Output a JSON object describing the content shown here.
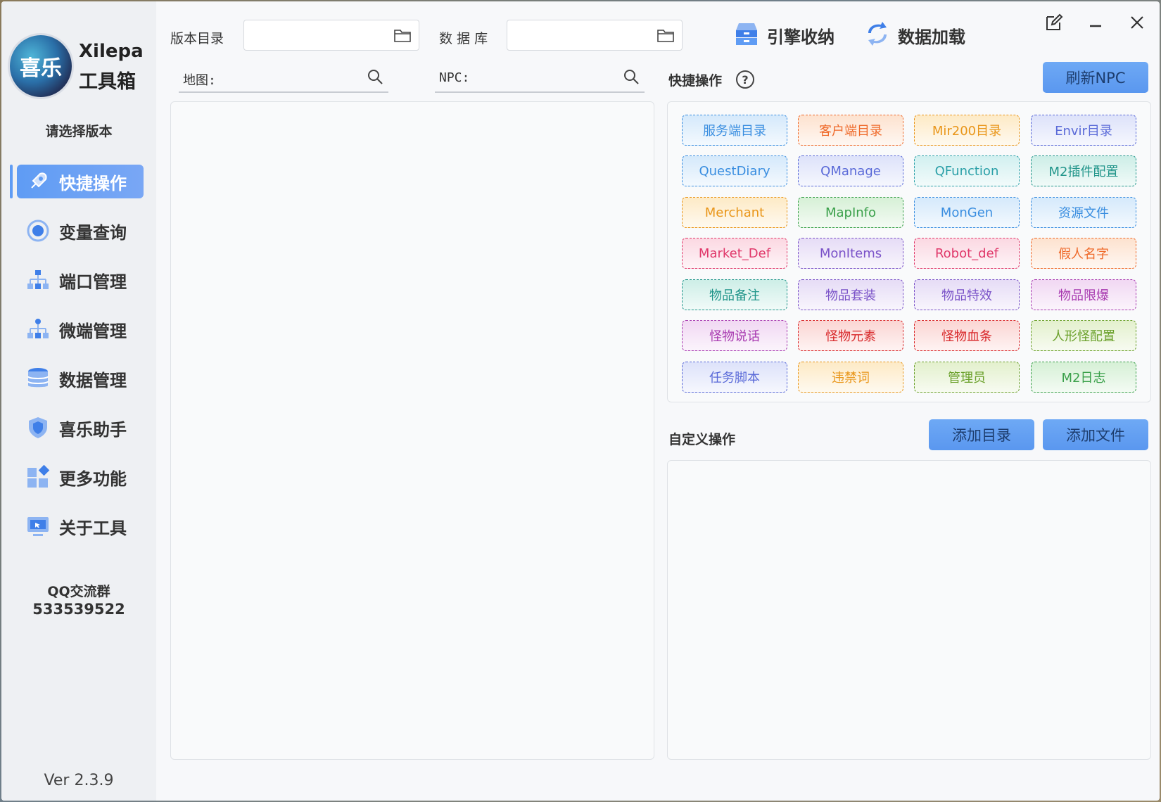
{
  "app": {
    "logo_glyph": "喜乐",
    "title": "Xilepa",
    "subtitle": "工具箱",
    "version_prompt": "请选择版本",
    "qq_label": "QQ交流群",
    "qq_number": "533539522",
    "version": "Ver 2.3.9"
  },
  "sidebar": {
    "items": [
      {
        "label": "快捷操作",
        "icon": "rocket-icon",
        "active": true
      },
      {
        "label": "变量查询",
        "icon": "variable-icon",
        "active": false
      },
      {
        "label": "端口管理",
        "icon": "network-icon",
        "active": false
      },
      {
        "label": "微端管理",
        "icon": "micro-network-icon",
        "active": false
      },
      {
        "label": "数据管理",
        "icon": "database-icon",
        "active": false
      },
      {
        "label": "喜乐助手",
        "icon": "shield-icon",
        "active": false
      },
      {
        "label": "更多功能",
        "icon": "apps-icon",
        "active": false
      },
      {
        "label": "关于工具",
        "icon": "monitor-icon",
        "active": false
      }
    ]
  },
  "toolbar": {
    "version_dir_label": "版本目录",
    "version_dir_value": "",
    "database_label": "数 据 库",
    "database_value": "",
    "map_label": "地图:",
    "npc_label": "NPC:",
    "engine_label": "引擎收纳",
    "data_load_label": "数据加载"
  },
  "quick": {
    "title": "快捷操作",
    "help": "?",
    "refresh_npc": "刷新NPC",
    "buttons": [
      {
        "label": "服务端目录",
        "color": "#3a8ee0",
        "bg": "#d5e9fb"
      },
      {
        "label": "客户端目录",
        "color": "#ef6a2a",
        "bg": "#fde2cf"
      },
      {
        "label": "Mir200目录",
        "color": "#e9961a",
        "bg": "#fdeac6"
      },
      {
        "label": "Envir目录",
        "color": "#5a6ad8",
        "bg": "#dde2fa"
      },
      {
        "label": "QuestDiary",
        "color": "#3a8ee0",
        "bg": "#d5e9fb"
      },
      {
        "label": "QManage",
        "color": "#5a6ad8",
        "bg": "#dde2fa"
      },
      {
        "label": "QFunction",
        "color": "#2aa0a8",
        "bg": "#d2f0f0"
      },
      {
        "label": "M2插件配置",
        "color": "#21958a",
        "bg": "#cdeee7"
      },
      {
        "label": "Merchant",
        "color": "#e9961a",
        "bg": "#fdeac6"
      },
      {
        "label": "MapInfo",
        "color": "#3aa04a",
        "bg": "#d6f0d6"
      },
      {
        "label": "MonGen",
        "color": "#3a8ee0",
        "bg": "#d5e9fb"
      },
      {
        "label": "资源文件",
        "color": "#3a8ee0",
        "bg": "#d5e9fb"
      },
      {
        "label": "Market_Def",
        "color": "#e0386a",
        "bg": "#fbd8e2"
      },
      {
        "label": "MonItems",
        "color": "#7a52c8",
        "bg": "#e6dcf6"
      },
      {
        "label": "Robot_def",
        "color": "#e0386a",
        "bg": "#fbd8e2"
      },
      {
        "label": "假人名字",
        "color": "#ef6a2a",
        "bg": "#fde2cf"
      },
      {
        "label": "物品备注",
        "color": "#21958a",
        "bg": "#cdeee7"
      },
      {
        "label": "物品套装",
        "color": "#7a52c8",
        "bg": "#e6dcf6"
      },
      {
        "label": "物品特效",
        "color": "#7a52c8",
        "bg": "#e6dcf6"
      },
      {
        "label": "物品限爆",
        "color": "#a83ab0",
        "bg": "#f1d8f3"
      },
      {
        "label": "怪物说话",
        "color": "#a83ab0",
        "bg": "#f1d8f3"
      },
      {
        "label": "怪物元素",
        "color": "#d8282a",
        "bg": "#fbd5d3"
      },
      {
        "label": "怪物血条",
        "color": "#d8282a",
        "bg": "#fbd5d3"
      },
      {
        "label": "人形怪配置",
        "color": "#6aa02a",
        "bg": "#e3f0cd"
      },
      {
        "label": "任务脚本",
        "color": "#5a6ad8",
        "bg": "#dde2fa"
      },
      {
        "label": "违禁词",
        "color": "#e9961a",
        "bg": "#fdeac6"
      },
      {
        "label": "管理员",
        "color": "#6aa02a",
        "bg": "#e3f0cd"
      },
      {
        "label": "M2日志",
        "color": "#3aa04a",
        "bg": "#d6f0d6"
      }
    ]
  },
  "custom": {
    "title": "自定义操作",
    "add_dir": "添加目录",
    "add_file": "添加文件"
  }
}
